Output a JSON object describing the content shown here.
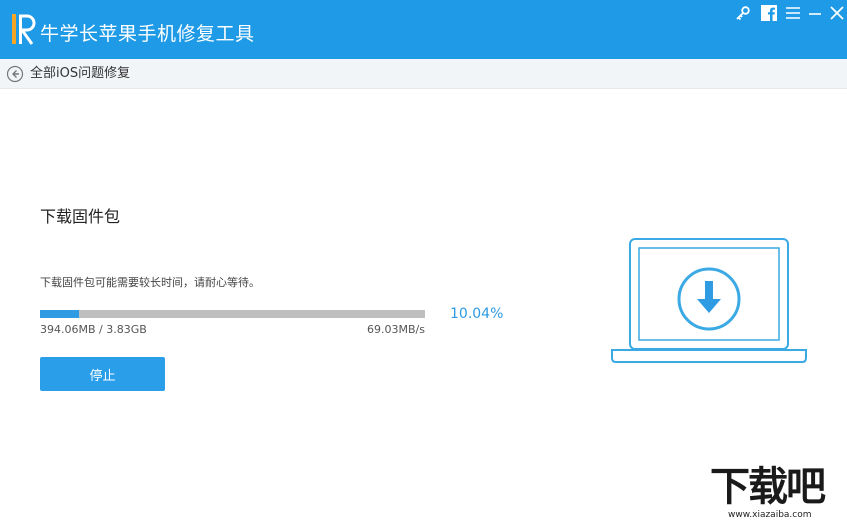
{
  "window": {
    "title": "牛学长苹果手机修复工具",
    "controls": [
      "key-icon",
      "facebook-icon",
      "menu-icon",
      "minimize-icon",
      "close-icon"
    ]
  },
  "breadcrumb": {
    "label": "全部iOS问题修复",
    "icon": "back-arrow-icon"
  },
  "main": {
    "section_title": "下载固件包",
    "hint": "下载固件包可能需要较长时间，请耐心等待。",
    "progress": {
      "percent_label": "10.04%",
      "percent": 10.04,
      "downloaded": "394.06MB / 3.83GB",
      "speed": "69.03MB/s"
    },
    "stop_button": "停止",
    "illustration_icon": "laptop-download-icon"
  },
  "watermark": {
    "text": "下载吧",
    "url": "www.xiazaiba.com"
  },
  "colors": {
    "titlebar": "#1e9ae6",
    "accent": "#2f9be3",
    "button": "#2a9ee8",
    "track": "#bfbfbf",
    "illustration_stroke": "#3aa9e4"
  }
}
